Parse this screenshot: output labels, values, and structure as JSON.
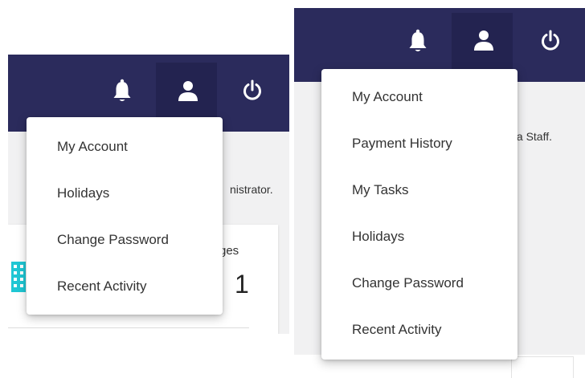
{
  "left": {
    "menu_items": [
      {
        "label": "My Account"
      },
      {
        "label": "Holidays"
      },
      {
        "label": "Change Password"
      },
      {
        "label": "Recent Activity"
      }
    ],
    "background_text": "nistrator.",
    "card": {
      "title": "ges",
      "count": "1"
    }
  },
  "right": {
    "menu_items": [
      {
        "label": "My Account"
      },
      {
        "label": "Payment History"
      },
      {
        "label": "My Tasks"
      },
      {
        "label": "Holidays"
      },
      {
        "label": "Change Password"
      },
      {
        "label": "Recent Activity"
      }
    ],
    "background_text": "s a Staff."
  },
  "icons": {
    "notifications": "bell-icon",
    "account": "person-icon",
    "logout": "power-icon",
    "card": "building-icon"
  },
  "colors": {
    "topbar": "#2b2b5c",
    "active_nav": "#232350",
    "card_icon": "#1fc7d4"
  }
}
